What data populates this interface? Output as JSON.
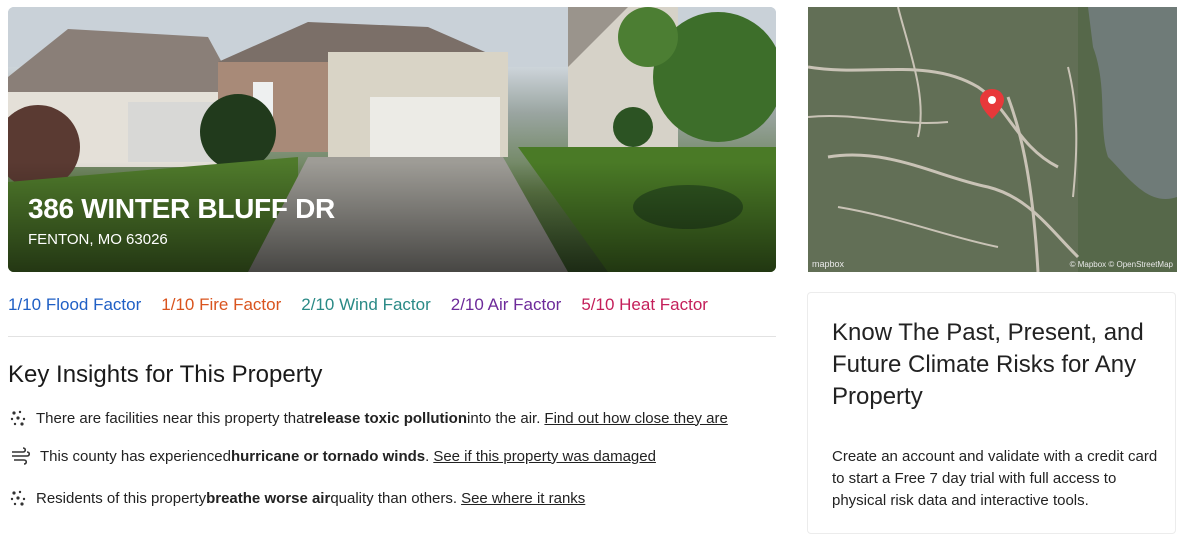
{
  "property": {
    "address_line1": "386 WINTER BLUFF DR",
    "address_line2": "FENTON, MO 63026"
  },
  "map": {
    "credit_left": "mapbox",
    "credit_right": "© Mapbox © OpenStreetMap"
  },
  "factors": [
    {
      "score": "1/10",
      "label": "Flood Factor",
      "color": "#1f5fc5"
    },
    {
      "score": "1/10",
      "label": "Fire Factor",
      "color": "#d9541e"
    },
    {
      "score": "2/10",
      "label": "Wind Factor",
      "color": "#2a8a86"
    },
    {
      "score": "2/10",
      "label": "Air Factor",
      "color": "#6d2a9a"
    },
    {
      "score": "5/10",
      "label": "Heat Factor",
      "color": "#c41f5a"
    }
  ],
  "insights": {
    "title": "Key Insights for This Property",
    "items": [
      {
        "icon": "particles-icon",
        "pre": "There are facilities near this property that ",
        "bold": "release toxic pollution",
        "post": " into the air.",
        "link": "Find out how close they are"
      },
      {
        "icon": "wind-icon",
        "pre": "This county has experienced ",
        "bold": "hurricane or tornado winds",
        "post": ".",
        "link": "See if this property was damaged"
      },
      {
        "icon": "particles-icon",
        "pre": "Residents of this property ",
        "bold": "breathe worse air",
        "post": " quality than others.",
        "link": "See where it ranks"
      }
    ]
  },
  "promo": {
    "title": "Know The Past, Present, and Future Climate Risks for Any Property",
    "body": "Create an account and validate with a credit card to start a Free 7 day trial with full access to physical risk data and interactive tools."
  }
}
